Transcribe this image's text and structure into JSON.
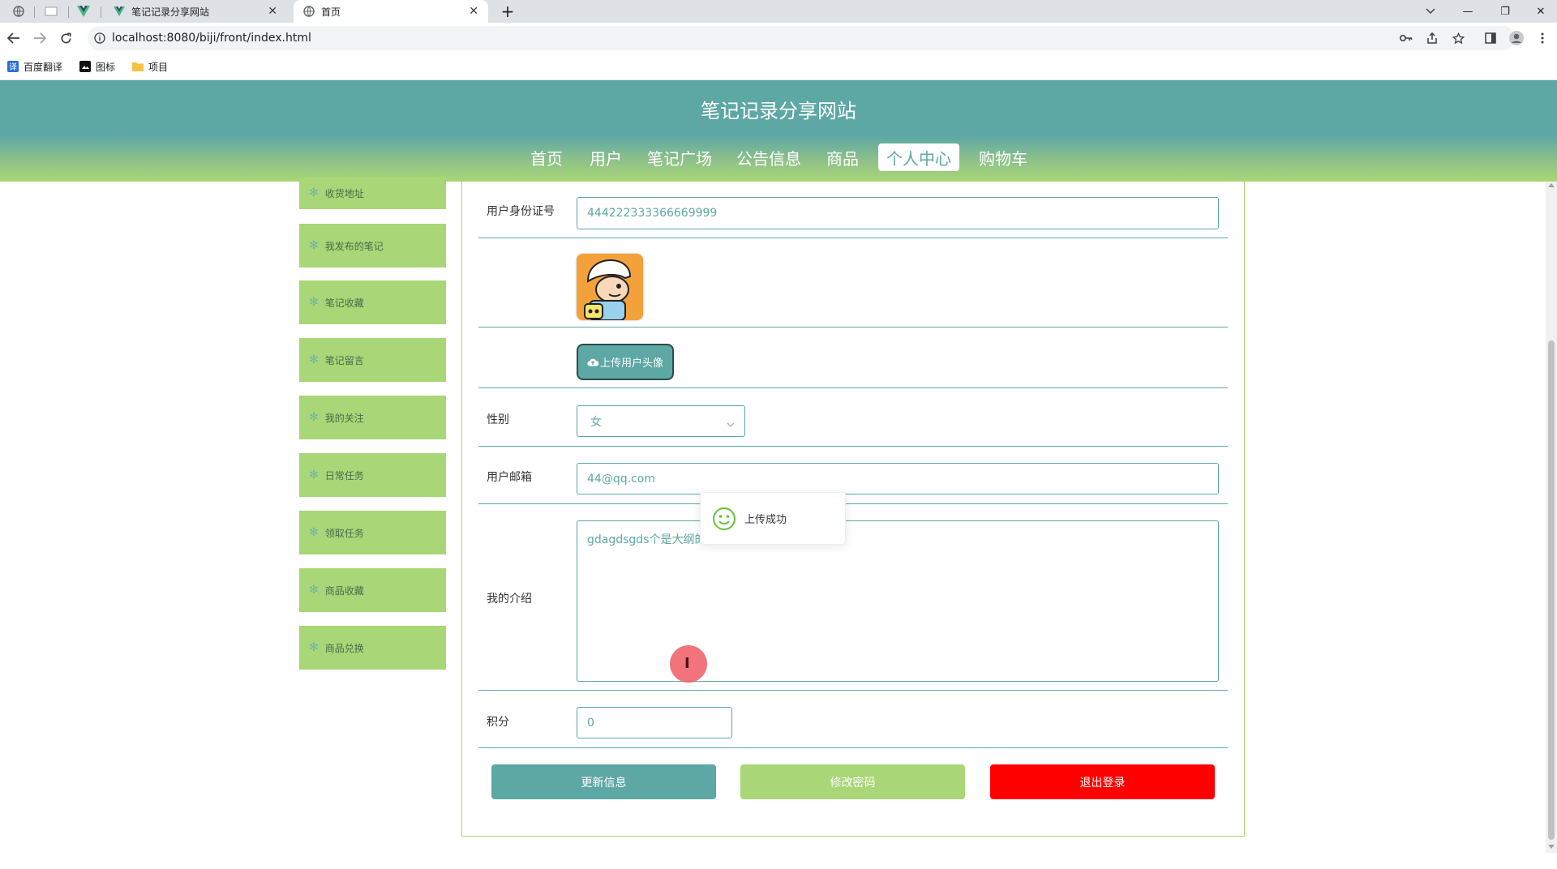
{
  "browser": {
    "tabs": [
      {
        "title": "笔记记录分享网站",
        "close": "✕"
      },
      {
        "title": "首页",
        "close": "✕"
      }
    ],
    "new_tab": "+",
    "window_controls": {
      "minimize": "—",
      "restore": "❐",
      "close": "✕"
    },
    "url": "localhost:8080/biji/front/index.html",
    "bookmarks": [
      "百度翻译",
      "图标",
      "项目"
    ]
  },
  "site": {
    "title": "笔记记录分享网站",
    "nav": [
      "首页",
      "用户",
      "笔记广场",
      "公告信息",
      "商品",
      "个人中心",
      "购物车"
    ],
    "active_nav": "个人中心"
  },
  "sidebar": {
    "items": [
      {
        "label": "收货地址"
      },
      {
        "label": "我发布的笔记"
      },
      {
        "label": "笔记收藏"
      },
      {
        "label": "笔记留言"
      },
      {
        "label": "我的关注"
      },
      {
        "label": "日常任务"
      },
      {
        "label": "领取任务"
      },
      {
        "label": "商品收藏"
      },
      {
        "label": "商品兑换"
      }
    ],
    "icon_glyph": "✻"
  },
  "form": {
    "id_number": {
      "label": "用户身份证号",
      "value": "444222333366669999"
    },
    "upload_avatar_label": "上传用户头像",
    "gender": {
      "label": "性别",
      "value": "女"
    },
    "email": {
      "label": "用户邮箱",
      "value": "44@qq.com"
    },
    "intro": {
      "label": "我的介绍",
      "value": "gdagdsgds个是大纲的"
    },
    "points": {
      "label": "积分",
      "value": "0"
    },
    "buttons": {
      "update": "更新信息",
      "change_password": "修改密码",
      "logout": "退出登录"
    }
  },
  "toast": {
    "message": "上传成功"
  },
  "colors": {
    "primary": "#5da8a4",
    "green": "#a9d676",
    "danger": "#ff0000"
  }
}
